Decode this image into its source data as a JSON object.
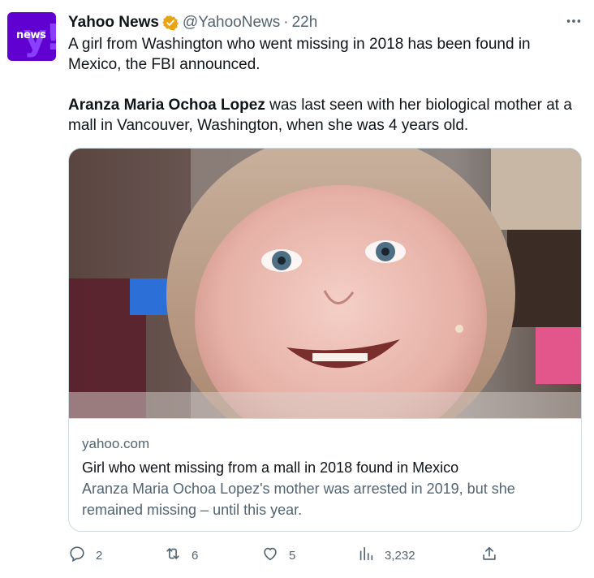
{
  "author": {
    "display_name": "Yahoo News",
    "handle": "@YahooNews",
    "separator": "·",
    "time": "22h",
    "avatar_text": "news",
    "avatar_mark": "y!",
    "avatar_color": "#6001d2",
    "verified_color": "#e8a317"
  },
  "tweet": {
    "line1": "A girl from Washington who went missing in 2018 has been found in Mexico, the FBI announced.",
    "name_bold": "Aranza Maria Ochoa Lopez",
    "line2_rest": " was last seen with her biological mother at a mall in Vancouver, Washington, when she was 4 years old."
  },
  "card": {
    "domain": "yahoo.com",
    "title": "Girl who went missing from a mall in 2018 found in Mexico",
    "description": "Aranza Maria Ochoa Lopez's mother was arrested in 2019, but she remained missing – until this year.",
    "image_subject": "close-up photo of a smiling young girl"
  },
  "actions": {
    "replies": "2",
    "retweets": "6",
    "likes": "5",
    "views": "3,232"
  },
  "icons": {
    "more": "more-options-icon",
    "reply": "reply-icon",
    "retweet": "retweet-icon",
    "like": "heart-icon",
    "views": "views-icon",
    "share": "share-icon",
    "verified": "verified-badge-icon"
  }
}
